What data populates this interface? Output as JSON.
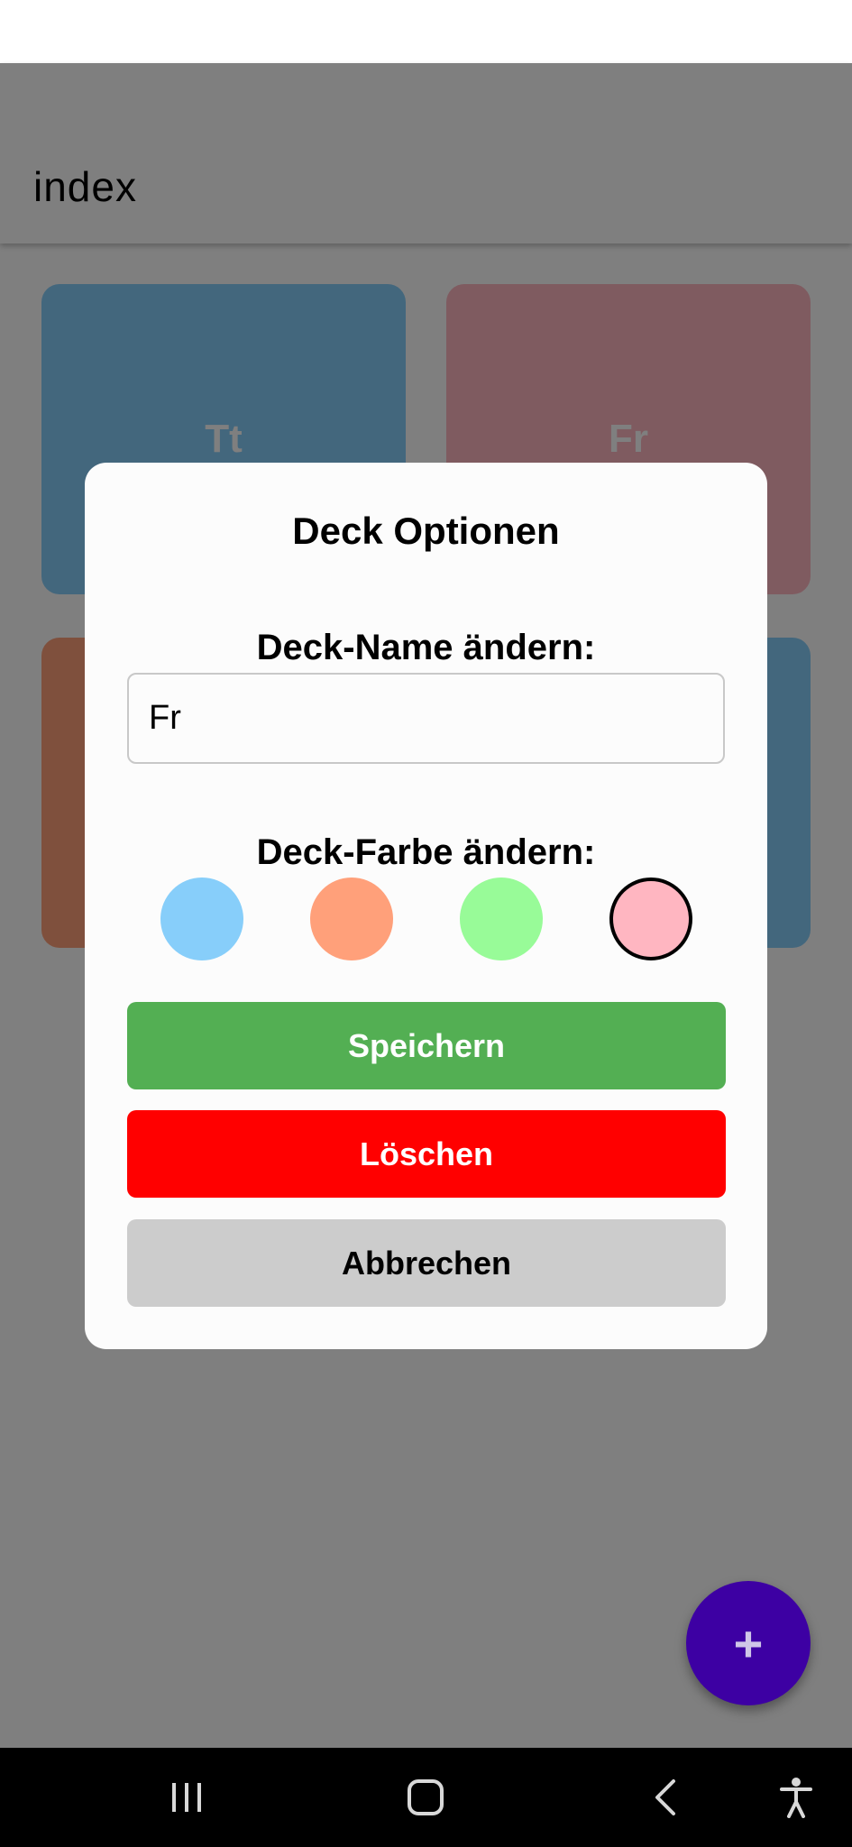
{
  "app": {
    "title": "index",
    "decks": [
      {
        "label": "Tt",
        "color": "#87cefa"
      },
      {
        "label": "Fr",
        "color": "#ffb6c1"
      },
      {
        "label": "",
        "color": "#ffa07a"
      },
      {
        "label": "",
        "color": "#87cefa"
      }
    ],
    "fab": {
      "icon": "plus-icon",
      "label": "+",
      "color": "#3d00a3"
    }
  },
  "modal": {
    "title": "Deck Optionen",
    "name_label": "Deck-Name ändern:",
    "name_value": "Fr",
    "color_label": "Deck-Farbe ändern:",
    "colors": [
      "#87cefa",
      "#ffa07a",
      "#98fb98",
      "#ffb6c1"
    ],
    "selected_color": "#ffb6c1",
    "save_label": "Speichern",
    "save_color": "#53af53",
    "delete_label": "Löschen",
    "delete_color": "#ff0000",
    "cancel_label": "Abbrechen",
    "cancel_color": "#cccccc"
  },
  "nav": {
    "recent_icon": "recent-apps-icon",
    "home_icon": "home-icon",
    "back_icon": "back-icon",
    "accessibility_icon": "accessibility-icon"
  }
}
